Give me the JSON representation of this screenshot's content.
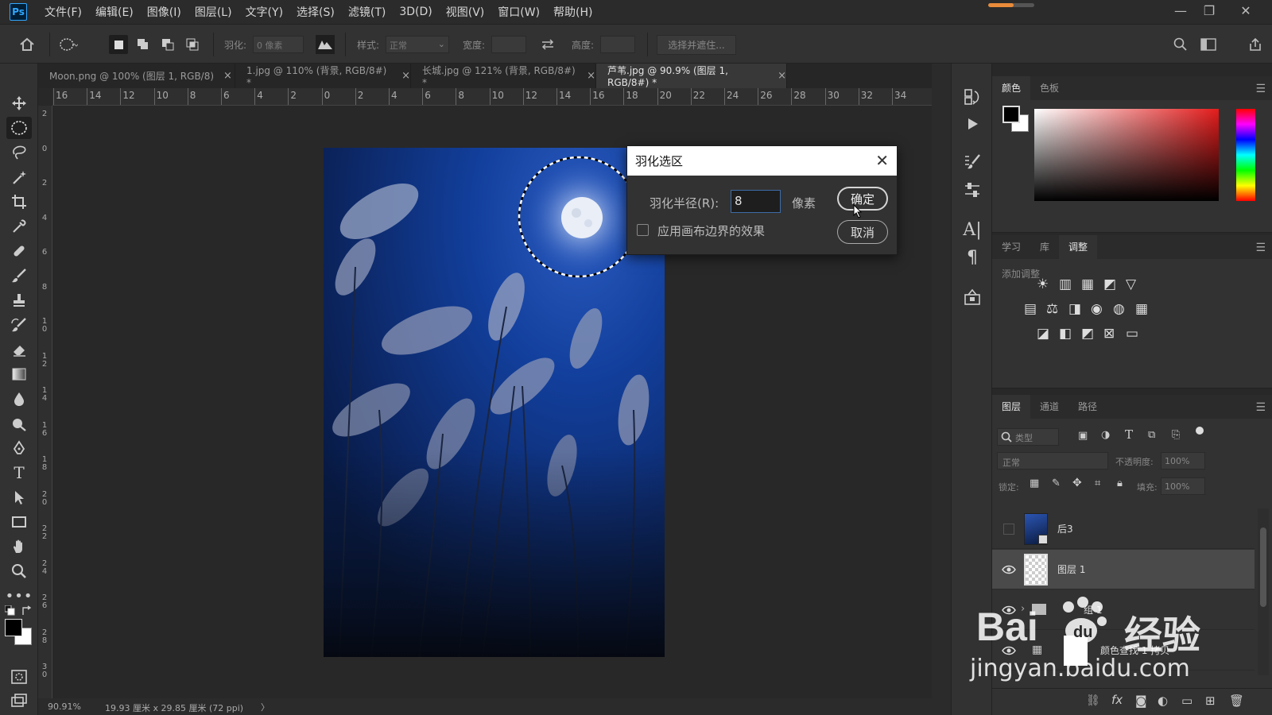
{
  "app": {
    "logo": "Ps"
  },
  "menu": [
    "文件(F)",
    "编辑(E)",
    "图像(I)",
    "图层(L)",
    "文字(Y)",
    "选择(S)",
    "滤镜(T)",
    "3D(D)",
    "视图(V)",
    "窗口(W)",
    "帮助(H)"
  ],
  "window_controls": {
    "minimize": "—",
    "restore": "❐",
    "close": "✕"
  },
  "progress": {
    "fraction": 0.55,
    "color": "#e98b3a"
  },
  "options": {
    "feather_label": "羽化:",
    "feather_value": "0 像素",
    "style_label": "样式:",
    "style_value": "正常",
    "width_label": "宽度:",
    "height_label": "高度:",
    "select_mask": "选择并遮住..."
  },
  "tabs": [
    {
      "label": "Moon.png @ 100% (图层 1, RGB/8)",
      "close": "×"
    },
    {
      "label": "1.jpg @ 110% (背景, RGB/8#) *",
      "close": "×"
    },
    {
      "label": "长城.jpg @ 121% (背景, RGB/8#) *",
      "close": "×"
    },
    {
      "label": "芦苇.jpg @ 90.9% (图层 1, RGB/8#) *",
      "close": "×"
    }
  ],
  "ruler_h": [
    "16",
    "14",
    "12",
    "10",
    "8",
    "6",
    "4",
    "2",
    "0",
    "2",
    "4",
    "6",
    "8",
    "10",
    "12",
    "14",
    "16",
    "18",
    "20",
    "22",
    "24",
    "26",
    "28",
    "30",
    "32",
    "34"
  ],
  "ruler_v": [
    "2",
    "0",
    "2",
    "4",
    "6",
    "8",
    "10",
    "12",
    "14",
    "16",
    "18",
    "20",
    "22",
    "24",
    "26",
    "28",
    "30"
  ],
  "status": {
    "zoom": "90.91%",
    "doc_info": "19.93 厘米 x 29.85 厘米 (72 ppi)",
    "arrow": "〉"
  },
  "dialog": {
    "title": "羽化选区",
    "radius_label": "羽化半径(R):",
    "radius_value": "8",
    "unit": "像素",
    "ok": "确定",
    "cancel": "取消",
    "checkbox_label": "应用画布边界的效果",
    "close": "✕"
  },
  "color_panel": {
    "tabs": [
      "颜色",
      "色板"
    ]
  },
  "adjust_panel": {
    "tabs": [
      "学习",
      "库",
      "调整"
    ],
    "add_label": "添加调整"
  },
  "layers_panel": {
    "tabs": [
      "图层",
      "通道",
      "路径"
    ],
    "search_placeholder": "类型",
    "blend_mode": "正常",
    "opacity_label": "不透明度:",
    "opacity_value": "100%",
    "lock_label": "锁定:",
    "fill_label": "填充:",
    "fill_value": "100%",
    "layers": [
      {
        "name": "后3",
        "visible": false
      },
      {
        "name": "图层 1",
        "visible": true,
        "selected": true
      },
      {
        "name": "组 1",
        "visible": true
      },
      {
        "name": "颜色查找 1 拷贝",
        "visible": true
      }
    ]
  },
  "watermark": {
    "brand": "Bai",
    "brand2": "经验",
    "url": "jingyan.baidu.com"
  }
}
